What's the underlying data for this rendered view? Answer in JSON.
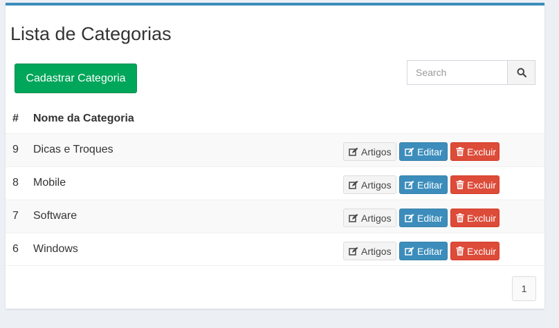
{
  "page": {
    "title": "Lista de Categorias"
  },
  "toolbar": {
    "add_label": "Cadastrar Categoria"
  },
  "search": {
    "placeholder": "Search",
    "icon": "search-icon"
  },
  "table": {
    "headers": [
      "#",
      "Nome da Categoria"
    ],
    "rows": [
      {
        "id": "9",
        "name": "Dicas e Troques"
      },
      {
        "id": "8",
        "name": "Mobile"
      },
      {
        "id": "7",
        "name": "Software"
      },
      {
        "id": "6",
        "name": "Windows"
      }
    ],
    "actions": {
      "articles": "Artigos",
      "edit": "Editar",
      "delete": "Excluir"
    }
  },
  "pagination": {
    "current_page": "1"
  },
  "colors": {
    "accent": "#3c8dbc",
    "success": "#00a65a",
    "primary": "#3c8dbc",
    "danger": "#dd4b39"
  }
}
